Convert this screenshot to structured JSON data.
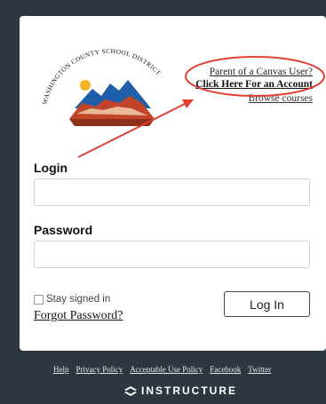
{
  "logo": {
    "text": "WASHINGTON COUNTY SCHOOL DISTRICT"
  },
  "links": {
    "parent": "Parent of a Canvas User?",
    "account": "Click Here For an Account",
    "browse": "Browse courses"
  },
  "form": {
    "login_label": "Login",
    "login_value": "",
    "password_label": "Password",
    "password_value": "",
    "stay_signed_in": "Stay signed in",
    "forgot_password": "Forgot Password?",
    "login_button": "Log In"
  },
  "footer": {
    "links": [
      "Help",
      "Privacy Policy",
      "Acceptable Use Policy",
      "Facebook",
      "Twitter"
    ],
    "brand": "INSTRUCTURE"
  },
  "colors": {
    "background": "#2c3742",
    "annotation": "#e0412f",
    "logo_red": "#c1442a",
    "logo_blue": "#1f5ea8",
    "logo_sun": "#f0b51f"
  },
  "icons": [
    "instructure-logo-icon"
  ]
}
